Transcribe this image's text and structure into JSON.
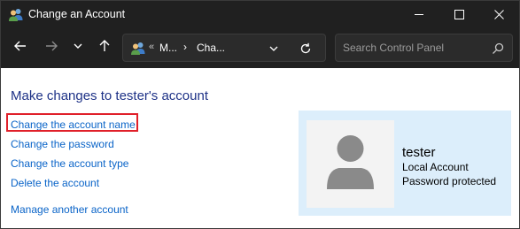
{
  "window": {
    "title": "Change an Account",
    "icon": "user-accounts-icon"
  },
  "titlebar_buttons": {
    "minimize_icon": "minimize-icon",
    "maximize_icon": "maximize-icon",
    "close_icon": "close-icon"
  },
  "navigation": {
    "back_icon": "arrow-left-icon",
    "forward_icon": "arrow-right-icon",
    "recent_icon": "chevron-down-icon",
    "up_icon": "arrow-up-icon"
  },
  "address_bar": {
    "icon": "user-accounts-icon",
    "overflow": "«",
    "crumbs": [
      "M...",
      "Cha..."
    ],
    "separator": "›",
    "dropdown_icon": "chevron-down-icon",
    "refresh_icon": "refresh-icon"
  },
  "search": {
    "placeholder": "Search Control Panel",
    "value": "",
    "icon": "search-icon"
  },
  "content": {
    "heading": "Make changes to tester's account",
    "links": [
      "Change the account name",
      "Change the password",
      "Change the account type",
      "Delete the account",
      "Manage another account"
    ],
    "highlighted_link_index": 0,
    "highlight_color": "#e0202a",
    "link_color": "#0a64c8",
    "heading_color": "#1e3287"
  },
  "account": {
    "name": "tester",
    "type": "Local Account",
    "status": "Password protected",
    "avatar_icon": "user-avatar-icon",
    "panel_color": "#dceefb"
  }
}
